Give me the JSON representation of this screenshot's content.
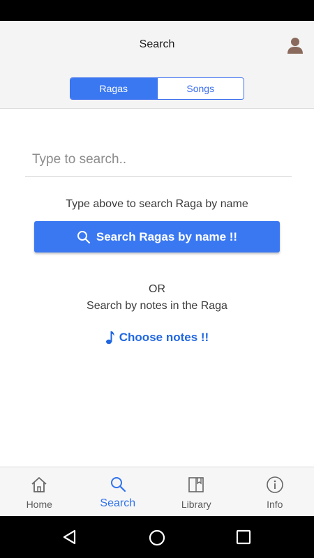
{
  "header": {
    "title": "Search"
  },
  "segments": [
    {
      "label": "Ragas",
      "active": true
    },
    {
      "label": "Songs",
      "active": false
    }
  ],
  "search": {
    "placeholder": "Type to search..",
    "value": ""
  },
  "hint": "Type above to search Raga by name",
  "search_button_label": "Search Ragas by name !!",
  "or_label": "OR",
  "notes_hint": "Search by notes in the Raga",
  "choose_notes_label": "Choose notes !!",
  "tabs": [
    {
      "label": "Home",
      "icon": "home-icon",
      "active": false
    },
    {
      "label": "Search",
      "icon": "search-icon",
      "active": true
    },
    {
      "label": "Library",
      "icon": "library-icon",
      "active": false
    },
    {
      "label": "Info",
      "icon": "info-icon",
      "active": false
    }
  ],
  "colors": {
    "accent": "#3a78f2",
    "link": "#1f66e0",
    "active_tab": "#2f72ee"
  }
}
